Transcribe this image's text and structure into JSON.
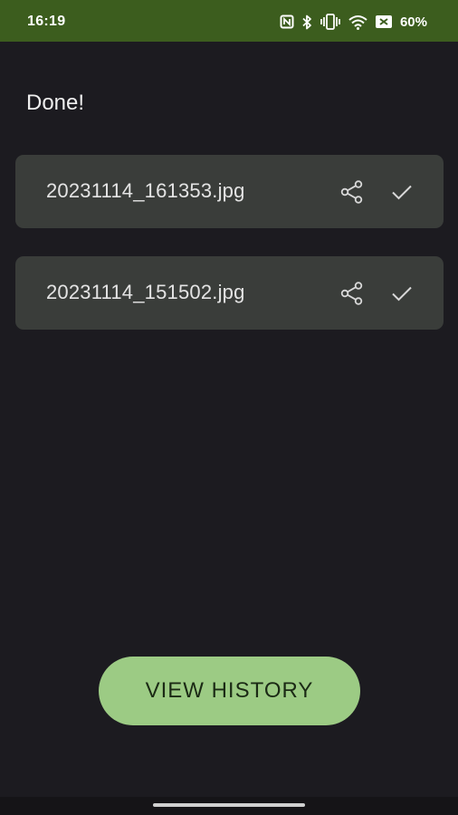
{
  "status_bar": {
    "time": "16:19",
    "battery": "60%",
    "icons": [
      "nfc-icon",
      "bluetooth-icon",
      "vibrate-icon",
      "wifi-icon",
      "battery-icon"
    ],
    "background": "#3c5d1e"
  },
  "main": {
    "heading": "Done!",
    "files": [
      {
        "name": "20231114_161353.jpg"
      },
      {
        "name": "20231114_151502.jpg"
      }
    ]
  },
  "actions": {
    "view_history_label": "VIEW HISTORY",
    "button_color": "#9ccb84"
  },
  "colors": {
    "background": "#1c1b20",
    "card": "#3a3d3a"
  }
}
